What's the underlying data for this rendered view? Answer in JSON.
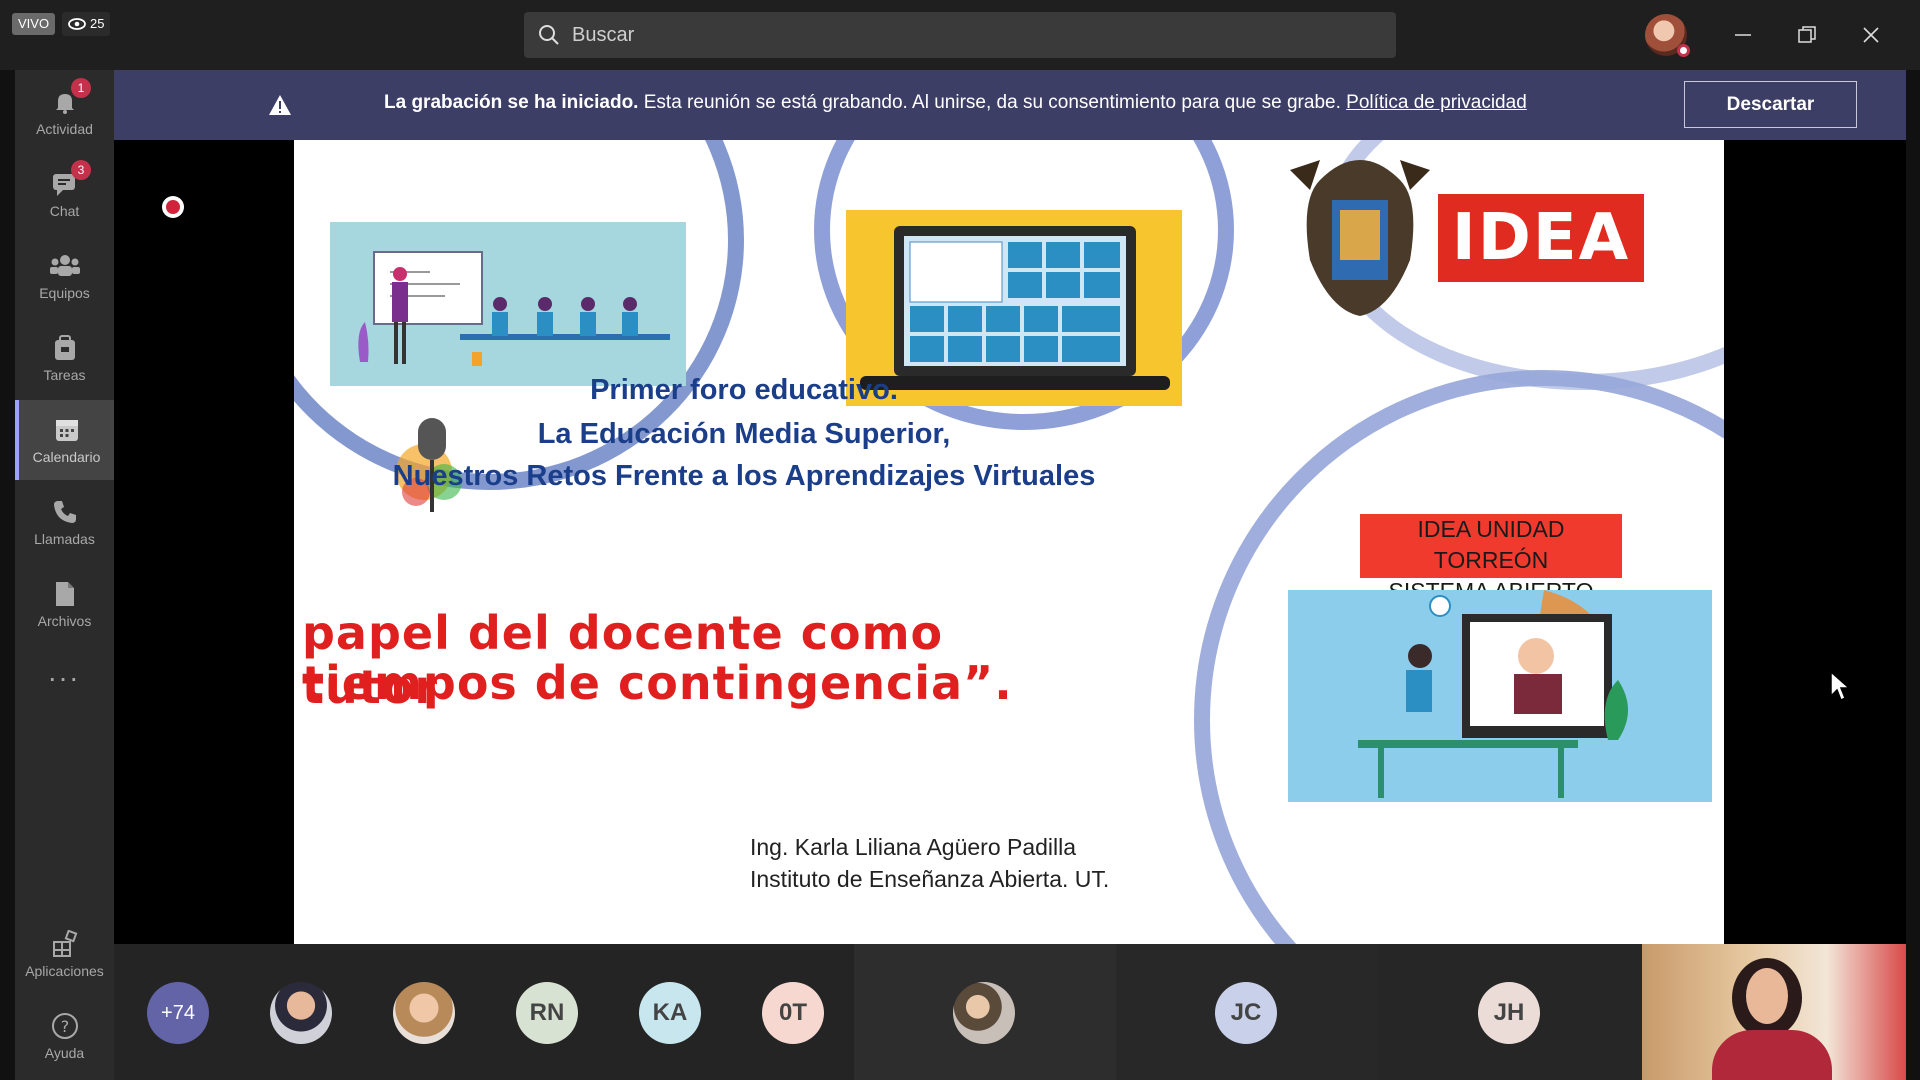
{
  "titlebar": {
    "live_label": "VIVO",
    "viewer_count": "25",
    "search_placeholder": "Buscar"
  },
  "rail": {
    "items": [
      {
        "label": "Actividad",
        "badge": "1"
      },
      {
        "label": "Chat",
        "badge": "3"
      },
      {
        "label": "Equipos"
      },
      {
        "label": "Tareas"
      },
      {
        "label": "Calendario"
      },
      {
        "label": "Llamadas"
      },
      {
        "label": "Archivos"
      },
      {
        "label": "Aplicaciones"
      },
      {
        "label": "Ayuda"
      }
    ],
    "more_label": "..."
  },
  "banner": {
    "bold": "La grabación se ha iniciado.",
    "text": " Esta reunión se está grabando. Al unirse, da su consentimiento para que se grabe. ",
    "link": "Política de privacidad",
    "dismiss_label": "Descartar"
  },
  "slide": {
    "title_line1": "Primer foro educativo.",
    "title_line2": "La Educación Media Superior,",
    "title_line3": "Nuestros Retos Frente a los Aprendizajes Virtuales",
    "red_line1": "papel del docente como tutor",
    "red_line2": "tiempos de contingencia”.",
    "author_line1": "Ing. Karla Liliana Agüero Padilla",
    "author_line2": "Instituto de Enseñanza Abierta. UT.",
    "logo_text": "IDEA",
    "tag_line1": "IDEA UNIDAD TORREÓN",
    "tag_line2": "SISTEMA ABIERTO"
  },
  "participants": {
    "overflow": "+74",
    "initials": [
      "RN",
      "KA",
      "0T",
      "JC",
      "JH"
    ]
  },
  "colors": {
    "banner": "#3d3e66",
    "accent": "#9ea2ff",
    "overflow_avatar": "#6264a7"
  }
}
